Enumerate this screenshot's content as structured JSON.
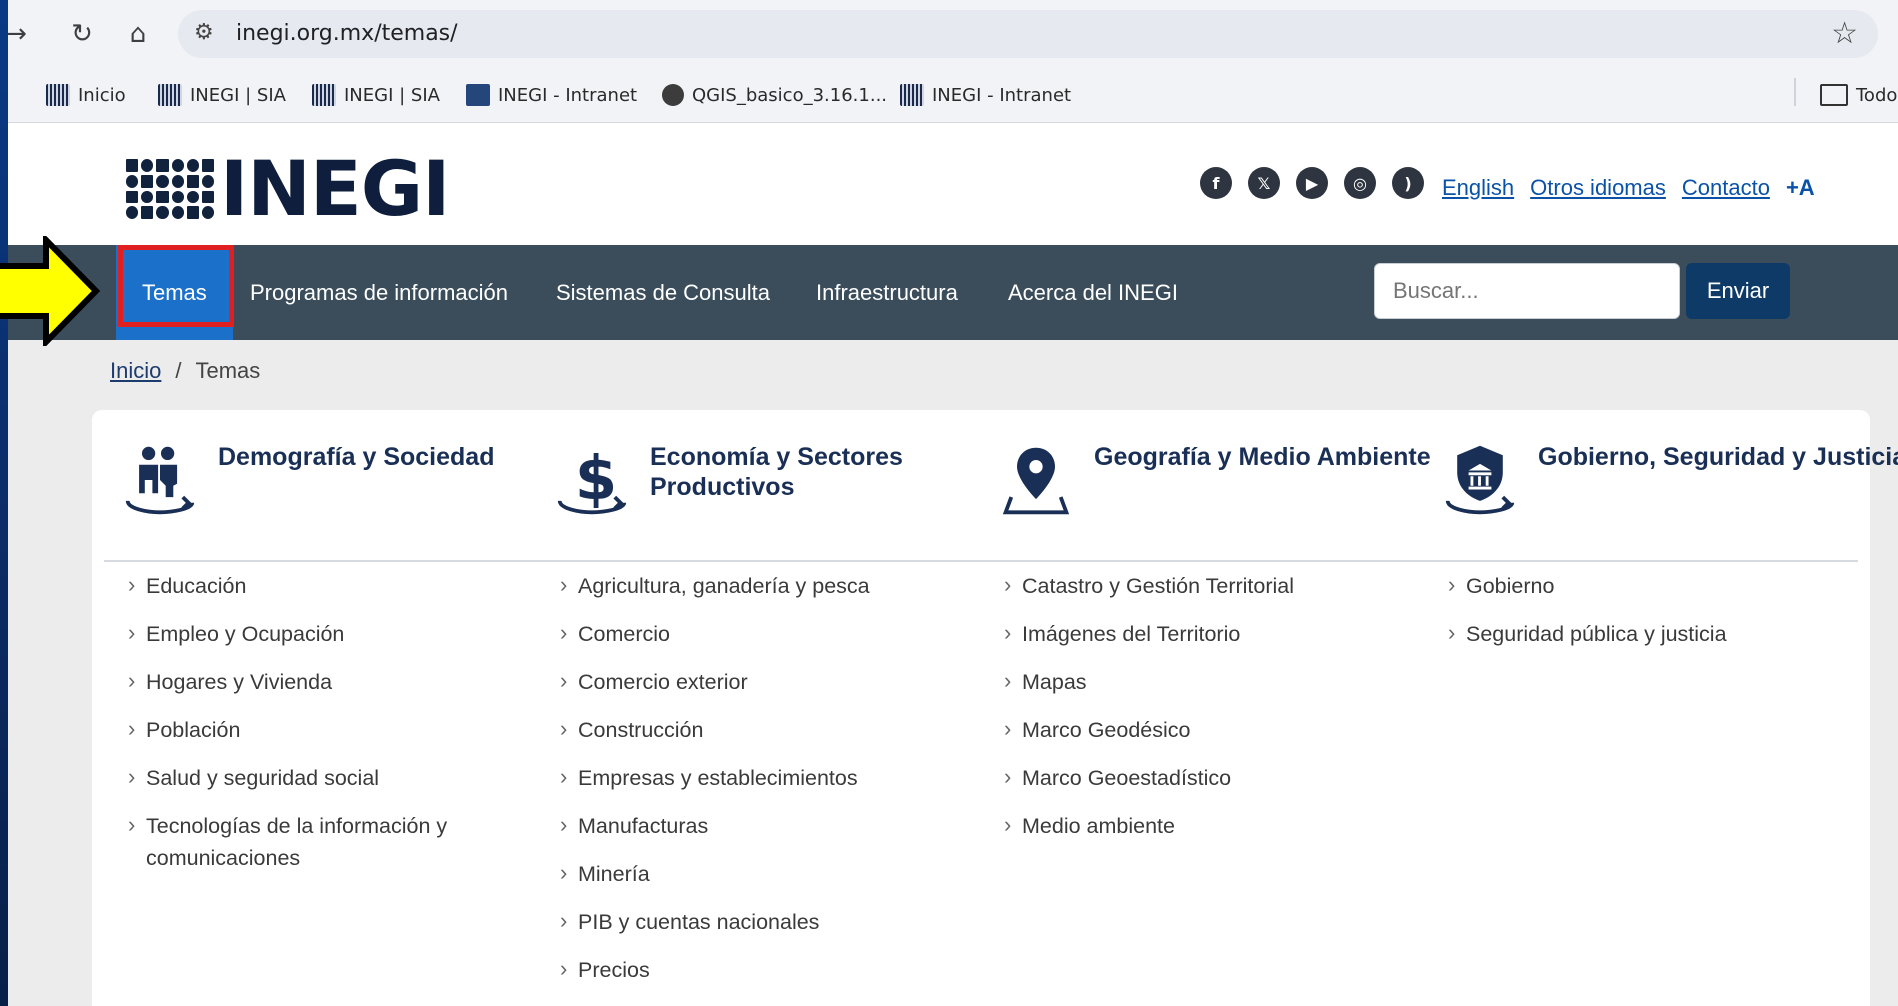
{
  "browser": {
    "url": "inegi.org.mx/temas/",
    "bookmarks": [
      "Inicio",
      "INEGI | SIA",
      "INEGI | SIA",
      "INEGI - Intranet",
      "QGIS_basico_3.16.1...",
      "INEGI - Intranet"
    ],
    "bookmarks_folder": "Todo"
  },
  "header": {
    "logo_text": "INEGI",
    "links": [
      "English",
      "Otros idiomas",
      "Contacto"
    ],
    "font_size_label": "+A"
  },
  "nav": {
    "items": [
      "Temas",
      "Programas de información",
      "Sistemas de Consulta",
      "Infraestructura",
      "Acerca del INEGI"
    ],
    "search_placeholder": "Buscar...",
    "search_button": "Enviar"
  },
  "breadcrumb": {
    "home": "Inicio",
    "separator": "/",
    "current": "Temas"
  },
  "columns": [
    {
      "title": "Demografía y Sociedad",
      "icon": "family-icon",
      "items": [
        "Educación",
        "Empleo y Ocupación",
        "Hogares y Vivienda",
        "Población",
        "Salud y seguridad social",
        "Tecnologías de la información y comunicaciones"
      ]
    },
    {
      "title": "Economía y Sectores Productivos",
      "icon": "dollar-icon",
      "items": [
        "Agricultura, ganadería y pesca",
        "Comercio",
        "Comercio exterior",
        "Construcción",
        "Empresas y establecimientos",
        "Manufacturas",
        "Minería",
        "PIB y cuentas nacionales",
        "Precios"
      ]
    },
    {
      "title": "Geografía y Medio Ambiente",
      "icon": "map-pin-icon",
      "items": [
        "Catastro y Gestión Territorial",
        "Imágenes del Territorio",
        "Mapas",
        "Marco Geodésico",
        "Marco Geoestadístico",
        "Medio ambiente"
      ]
    },
    {
      "title": "Gobierno, Seguridad y Justicia",
      "icon": "shield-building-icon",
      "items": [
        "Gobierno",
        "Seguridad pública y justicia"
      ]
    }
  ],
  "colors": {
    "nav_bg": "#3b4d5b",
    "active_tab": "#1b71c9",
    "highlight_box": "#e02020",
    "annotation_arrow": "#ffff00"
  }
}
